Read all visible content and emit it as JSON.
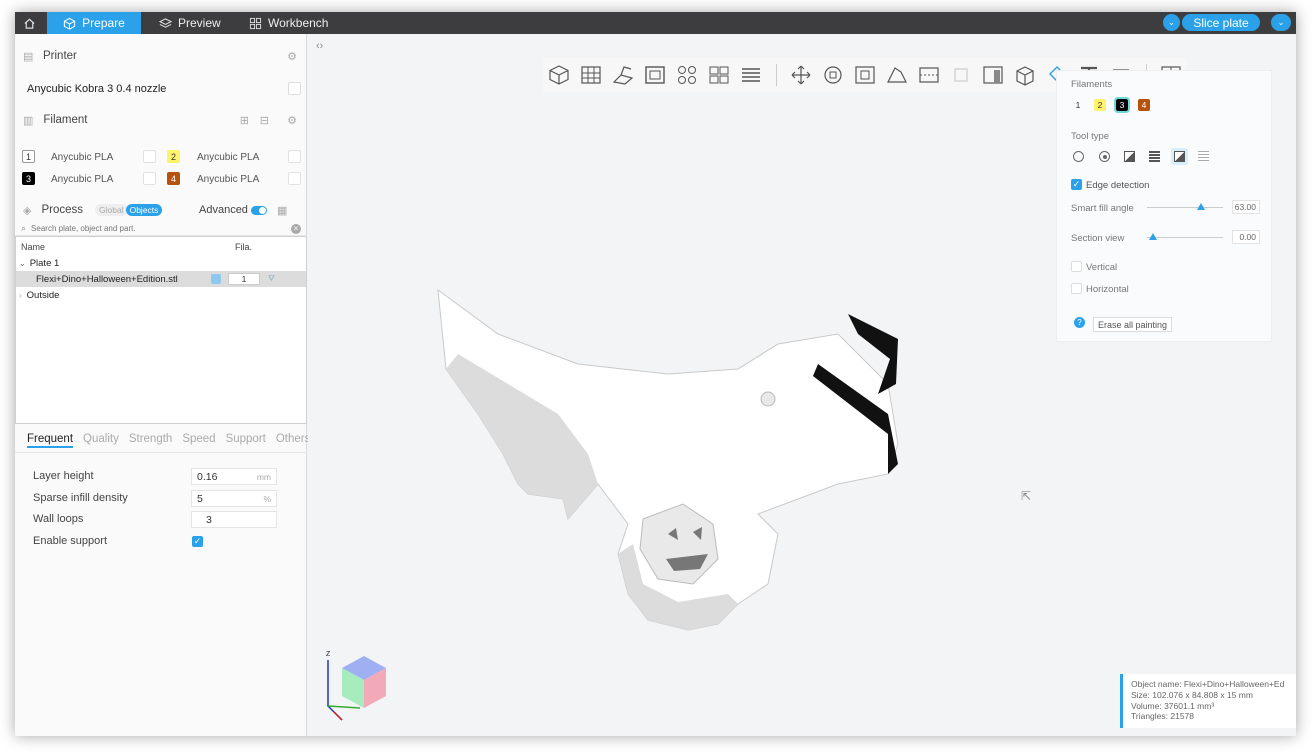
{
  "topbar": {
    "tabs": [
      {
        "label": "Prepare",
        "active": true
      },
      {
        "label": "Preview",
        "active": false
      },
      {
        "label": "Workbench",
        "active": false
      }
    ],
    "slice_label": "Slice plate"
  },
  "printer": {
    "title": "Printer",
    "selected": "Anycubic Kobra 3 0.4 nozzle"
  },
  "filament": {
    "title": "Filament",
    "items": [
      {
        "index": "1",
        "name": "Anycubic PLA",
        "color": "#ffffff"
      },
      {
        "index": "2",
        "name": "Anycubic PLA",
        "color": "#fff36b"
      },
      {
        "index": "3",
        "name": "Anycubic PLA",
        "color": "#000000"
      },
      {
        "index": "4",
        "name": "Anycubic PLA",
        "color": "#b5530e"
      }
    ]
  },
  "process": {
    "title": "Process",
    "toggle_global": "Global",
    "toggle_objects": "Objects",
    "advanced_label": "Advanced",
    "advanced_on": true
  },
  "search": {
    "placeholder": "Search plate, object and part."
  },
  "tree": {
    "columns": [
      "Name",
      "Fila."
    ],
    "rows": [
      {
        "label": "Plate 1"
      },
      {
        "label": "Flexi+Dino+Halloween+Edition.stl",
        "filament": "1"
      },
      {
        "label": "Outside"
      }
    ]
  },
  "settings_tabs": [
    "Frequent",
    "Quality",
    "Strength",
    "Speed",
    "Support",
    "Others"
  ],
  "settings": [
    {
      "label": "Layer height",
      "value": "0.16",
      "unit": "mm"
    },
    {
      "label": "Sparse infill density",
      "value": "5",
      "unit": "%"
    },
    {
      "label": "Wall loops",
      "value": "3",
      "unit": ""
    },
    {
      "label": "Enable support",
      "checked": true
    }
  ],
  "paint_panel": {
    "filaments_label": "Filaments",
    "filament_chips": [
      "1",
      "2",
      "3",
      "4"
    ],
    "selected_filament": "3",
    "tool_type_label": "Tool type",
    "edge_detection_label": "Edge detection",
    "edge_detection_checked": true,
    "smart_fill_label": "Smart fill angle",
    "smart_fill_value": "63.00",
    "section_view_label": "Section view",
    "section_view_value": "0.00",
    "vertical_label": "Vertical",
    "horizontal_label": "Horizontal",
    "erase_label": "Erase all painting"
  },
  "object_info": {
    "name": "Object name: Flexi+Dino+Halloween+Ed",
    "size": "Size: 102.076 x 84.808 x 15 mm",
    "volume": "Volume: 37601.1 mm³",
    "triangles": "Triangles: 21578"
  },
  "axis_label": "Z",
  "colors": {
    "accent": "#2aa1e8",
    "topbar": "#3d3d40"
  }
}
